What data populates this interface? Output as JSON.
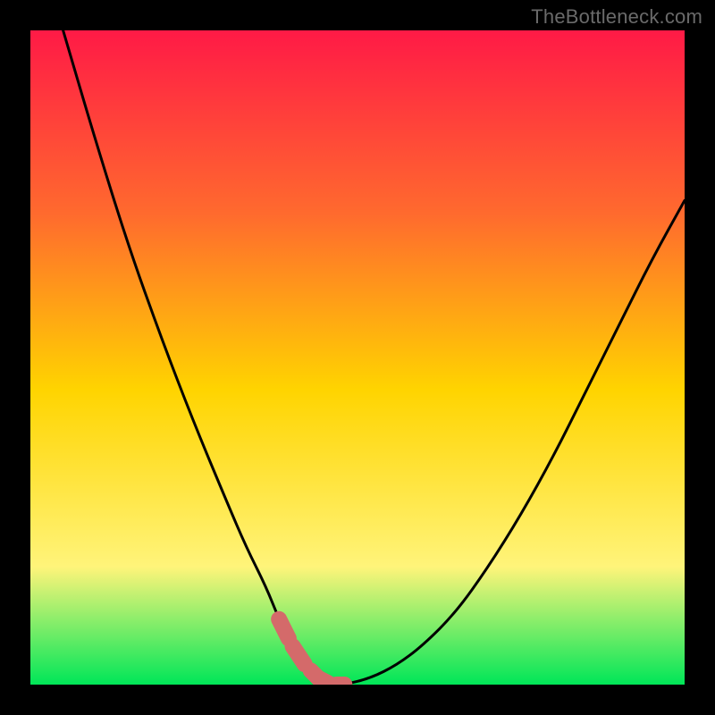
{
  "watermark": "TheBottleneck.com",
  "colors": {
    "background": "#000000",
    "gradient_top": "#ff1a46",
    "gradient_mid1": "#ff6a2e",
    "gradient_mid2": "#ffd400",
    "gradient_mid3": "#fff47a",
    "gradient_bottom": "#00e658",
    "curve": "#000000",
    "thick_segment": "#d46a6a",
    "watermark": "#6a6a6a"
  },
  "chart_data": {
    "type": "line",
    "title": "",
    "xlabel": "",
    "ylabel": "",
    "xlim": [
      0,
      100
    ],
    "ylim": [
      0,
      100
    ],
    "grid": false,
    "legend": false,
    "annotations": [],
    "series": [
      {
        "name": "bottleneck-curve",
        "x": [
          5,
          10,
          15,
          20,
          25,
          30,
          33,
          36,
          38,
          40,
          42,
          44,
          46,
          48,
          52,
          56,
          60,
          65,
          70,
          75,
          80,
          85,
          90,
          95,
          100
        ],
        "y": [
          100,
          83,
          67,
          53,
          40,
          28,
          21,
          15,
          10,
          6,
          3,
          1,
          0,
          0,
          1,
          3,
          6,
          11,
          18,
          26,
          35,
          45,
          55,
          65,
          74
        ]
      }
    ],
    "highlighted_segment": {
      "name": "optimal-range",
      "x_start": 38,
      "x_end": 50,
      "description": "thick salmon-colored band near curve minimum"
    }
  }
}
